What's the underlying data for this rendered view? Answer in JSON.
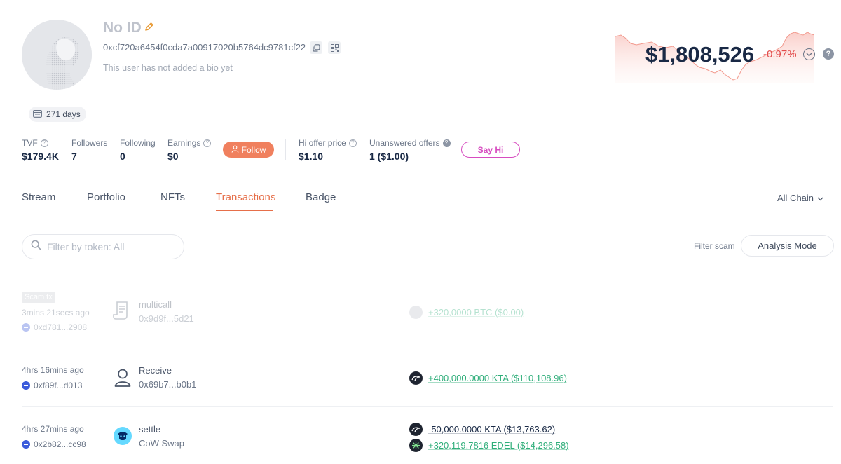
{
  "profile": {
    "name": "No ID",
    "address": "0xcf720a6454f0cda7a00917020b5764dc9781cf22",
    "bio": "This user has not added a bio yet",
    "days": "271 days"
  },
  "net_worth": {
    "value": "$1,808,526",
    "change": "-0.97%",
    "change_color": "#e34c4c"
  },
  "stats": {
    "tvf": {
      "label": "TVF",
      "value": "$179.4K"
    },
    "followers": {
      "label": "Followers",
      "value": "7"
    },
    "following": {
      "label": "Following",
      "value": "0"
    },
    "earnings": {
      "label": "Earnings",
      "value": "$0"
    },
    "hi_offer": {
      "label": "Hi offer price",
      "value": "$1.10"
    },
    "unanswered": {
      "label": "Unanswered offers",
      "value": "1 ($1.00)"
    }
  },
  "buttons": {
    "follow": "Follow",
    "say_hi": "Say Hi",
    "filter_scam": "Filter scam",
    "analysis_mode": "Analysis Mode"
  },
  "tabs": [
    {
      "label": "Stream"
    },
    {
      "label": "Portfolio"
    },
    {
      "label": "NFTs"
    },
    {
      "label": "Transactions"
    },
    {
      "label": "Badge"
    }
  ],
  "active_tab": "Transactions",
  "chain_select": "All Chain",
  "filter": {
    "placeholder": "Filter by token: All",
    "value": ""
  },
  "transactions": [
    {
      "scam_badge": "Scam tx",
      "time": "3mins 21secs ago",
      "chain_addr": "0xd781...2908",
      "type": "multicall",
      "sub": "0x9d9f...5d21",
      "tokens": [
        {
          "amount": "+320,0000 BTC ($0.00)",
          "icon": "token-icon"
        }
      ]
    },
    {
      "time": "4hrs 16mins ago",
      "chain_addr": "0xf89f...d013",
      "type": "Receive",
      "sub": "0x69b7...b0b1",
      "tokens": [
        {
          "amount": "+400,000.0000 KTA ($110,108.96)",
          "icon": "kta-icon"
        }
      ]
    },
    {
      "time": "4hrs 27mins ago",
      "chain_addr": "0x2b82...cc98",
      "type": "settle",
      "sub": "CoW Swap",
      "tokens": [
        {
          "amount": "-50,000.0000 KTA ($13,763.62)",
          "icon": "kta-icon"
        },
        {
          "amount": "+320,119.7816 EDEL ($14,296.58)",
          "icon": "edel-icon"
        }
      ]
    }
  ]
}
